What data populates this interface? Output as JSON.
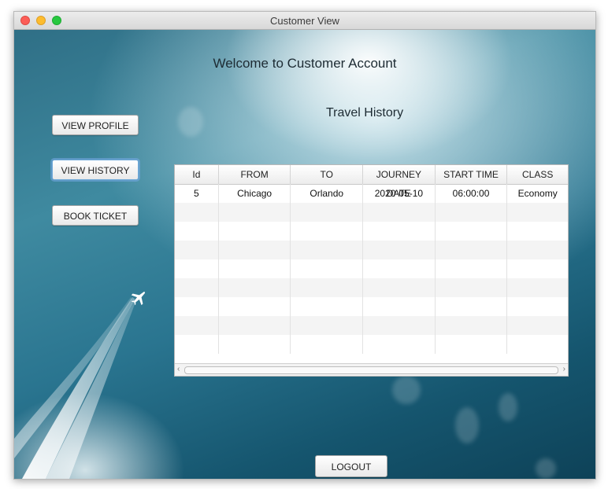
{
  "window": {
    "title": "Customer View"
  },
  "header": {
    "welcome": "Welcome to Customer Account"
  },
  "sidebar": {
    "view_profile": "VIEW PROFILE",
    "view_history": "VIEW HISTORY",
    "book_ticket": "BOOK TICKET"
  },
  "history": {
    "title": "Travel History",
    "columns": [
      "Id",
      "FROM",
      "TO",
      "JOURNEY DATE",
      "START TIME",
      "CLASS"
    ],
    "rows": [
      [
        "5",
        "Chicago",
        "Orlando",
        "2020-05-10",
        "06:00:00",
        "Economy"
      ]
    ]
  },
  "footer": {
    "logout": "LOGOUT"
  },
  "icons": {
    "airplane": "airplane-icon"
  }
}
